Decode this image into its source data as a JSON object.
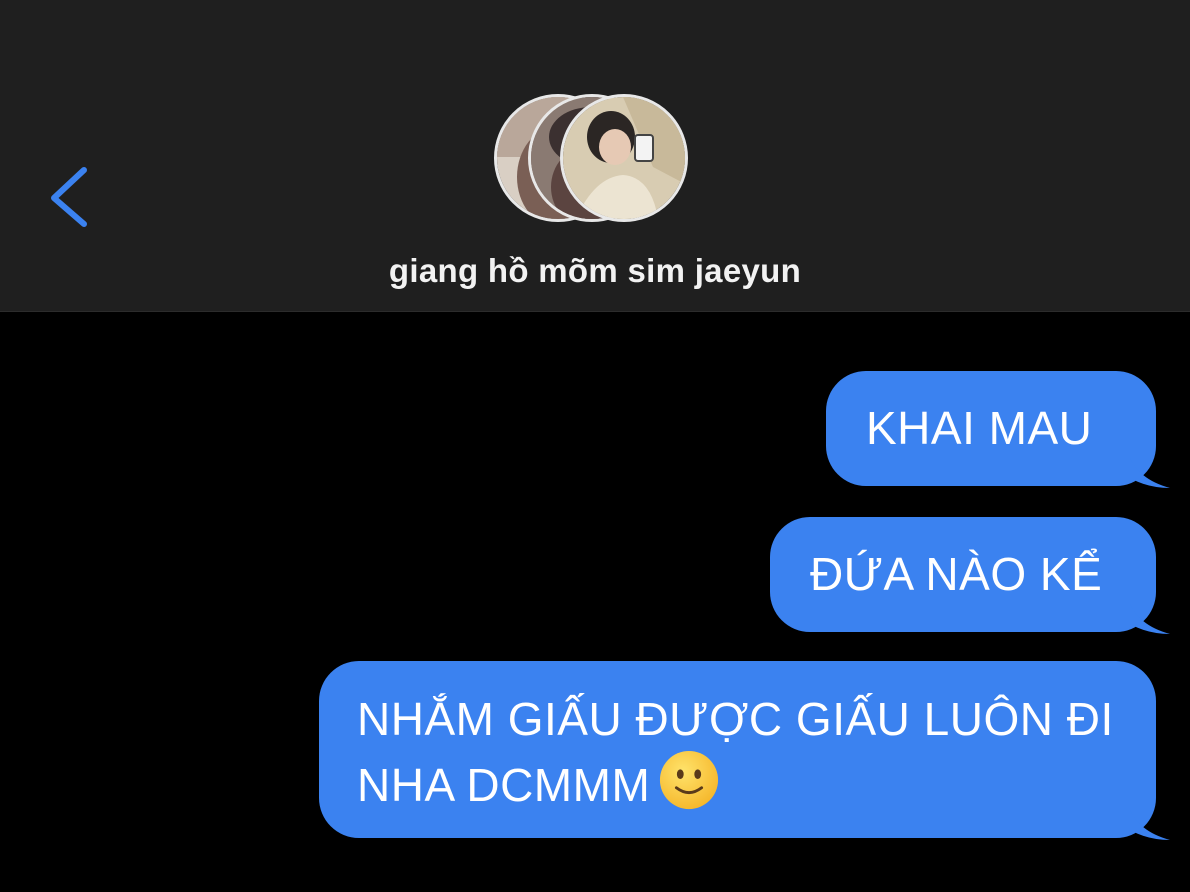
{
  "header": {
    "back_icon": "chevron-left-icon",
    "accent_color": "#3b82f0",
    "group_avatars": [
      "group-member-avatar-1",
      "group-member-avatar-2",
      "group-member-avatar-3"
    ],
    "title": "giang hồ mõm sim jaeyun"
  },
  "messages": [
    {
      "direction": "outgoing",
      "text": "KHAI MAU"
    },
    {
      "direction": "outgoing",
      "text": "ĐỨA NÀO KỂ"
    },
    {
      "direction": "outgoing",
      "text": "NHẮM GIẤU ĐƯỢC GIẤU LUÔN ĐI NHA DCMMM",
      "emoji": "slightly-smiling-face-icon"
    }
  ],
  "colors": {
    "bubble_outgoing": "#3b82f0",
    "header_background": "#1f1f1f",
    "chat_background": "#000000"
  }
}
